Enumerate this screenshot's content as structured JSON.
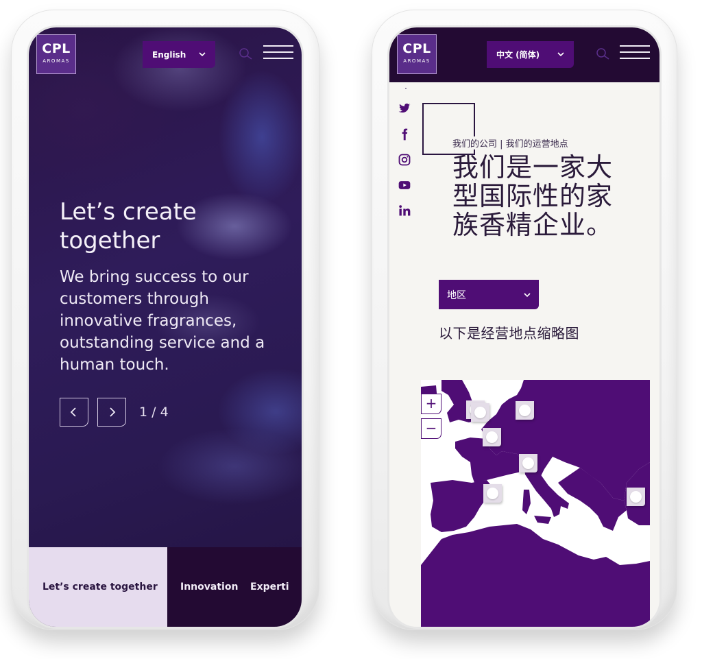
{
  "brand": {
    "logo_main": "CPL",
    "logo_sub": "AROMAS",
    "accent_color": "#4f0d75",
    "dark_color": "#230a33"
  },
  "left_phone": {
    "header": {
      "language_selected": "English",
      "search_icon": "search-icon",
      "menu_icon": "hamburger-menu-icon"
    },
    "hero": {
      "title": "Let’s create together",
      "body": "We bring success to our customers through innovative fragrances, outstanding service and a human touch.",
      "prev_icon": "chevron-left-icon",
      "next_icon": "chevron-right-icon",
      "slide_counter": "1 / 4"
    },
    "tabs": [
      {
        "label": "Let’s create together",
        "active": true
      },
      {
        "label": "Innovation",
        "active": false
      },
      {
        "label": "Experti",
        "active": false
      }
    ]
  },
  "right_phone": {
    "header": {
      "language_selected": "中文 (简体)",
      "search_icon": "search-icon",
      "menu_icon": "hamburger-menu-icon"
    },
    "social": [
      {
        "name": "twitter-icon"
      },
      {
        "name": "facebook-icon"
      },
      {
        "name": "instagram-icon"
      },
      {
        "name": "youtube-icon"
      },
      {
        "name": "linkedin-icon"
      }
    ],
    "breadcrumb": "我们的公司 | 我们的运营地点",
    "title": "我们是一家大型国际性的家族香精企业。",
    "region_select": "地区",
    "map_caption": "以下是经营地点缩略图",
    "map": {
      "zoom_in_label": "+",
      "zoom_out_label": "−",
      "marker_count": 7
    }
  }
}
